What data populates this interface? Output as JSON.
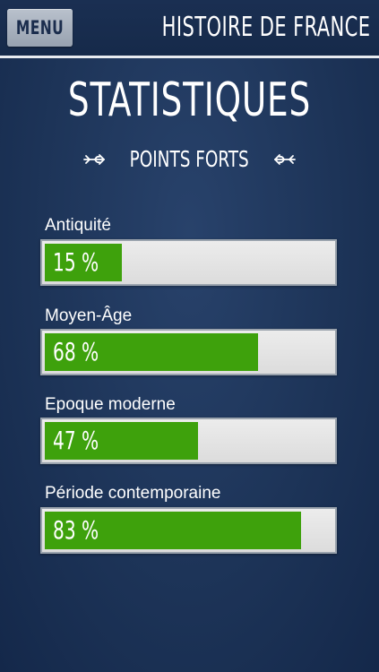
{
  "header": {
    "menu_label": "MENU",
    "app_title": "HISTOIRE DE FRANCE"
  },
  "page": {
    "title": "STATISTIQUES",
    "subtitle": "POINTS FORTS"
  },
  "stats": [
    {
      "label": "Antiquité",
      "percent": 15,
      "value_text": "15 %"
    },
    {
      "label": "Moyen-Âge",
      "percent": 68,
      "value_text": "68 %"
    },
    {
      "label": "Epoque moderne",
      "percent": 47,
      "value_text": "47 %"
    },
    {
      "label": "Période contemporaine",
      "percent": 83,
      "value_text": "83 %"
    }
  ],
  "colors": {
    "background": "#1d3458",
    "bar_fill": "#3ea10c",
    "bar_track": "#e4e4e4",
    "text": "#ffffff"
  }
}
